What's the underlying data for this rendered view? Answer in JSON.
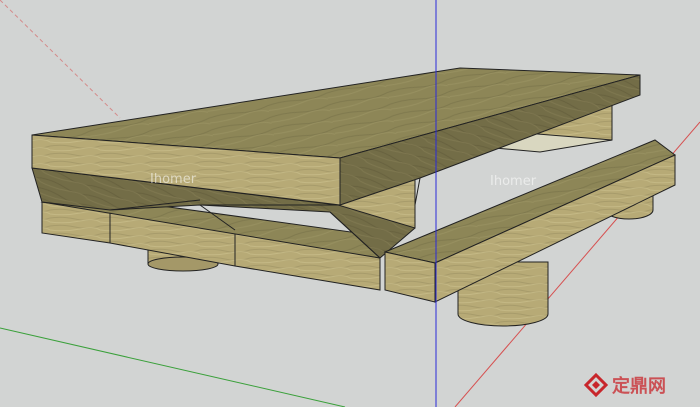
{
  "watermark": {
    "text_left": "Ihomer",
    "text_right": "Ihomer",
    "brand_cn": "定鼎网"
  },
  "icons": {
    "brand_logo": "diamond-house-logo-icon"
  },
  "colors": {
    "background": "#d2d4d3",
    "axis_blue": "#2a2ad8",
    "axis_red": "#d65050",
    "axis_green": "#3aa03a",
    "wood_top": "#8d8657",
    "wood_side": "#b9ad79",
    "wood_dark": "#6d6844",
    "brand_red": "#c8262b"
  }
}
